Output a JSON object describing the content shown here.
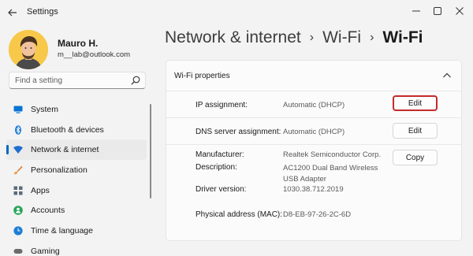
{
  "window": {
    "title": "Settings"
  },
  "user": {
    "name": "Mauro H.",
    "email": "m__lab@outlook.com"
  },
  "search": {
    "placeholder": "Find a setting"
  },
  "sidebar": {
    "items": [
      {
        "label": "System",
        "icon": "system-icon",
        "color": "#0a74d4"
      },
      {
        "label": "Bluetooth & devices",
        "icon": "bluetooth-icon",
        "color": "#1b7ad6"
      },
      {
        "label": "Network & internet",
        "icon": "wifi-icon",
        "color": "#1f6fcf",
        "active": true
      },
      {
        "label": "Personalization",
        "icon": "brush-icon",
        "color": "#d9763a"
      },
      {
        "label": "Apps",
        "icon": "apps-icon",
        "color": "#5b6b7c"
      },
      {
        "label": "Accounts",
        "icon": "accounts-icon",
        "color": "#2aa55b"
      },
      {
        "label": "Time & language",
        "icon": "globe-clock-icon",
        "color": "#1e7ed4"
      },
      {
        "label": "Gaming",
        "icon": "gaming-icon",
        "color": "#6b6b6b"
      }
    ]
  },
  "breadcrumb": {
    "items": [
      "Network & internet",
      "Wi-Fi"
    ],
    "current": "Wi-Fi",
    "separator": "›"
  },
  "panel": {
    "title": "Wi-Fi properties",
    "ip": {
      "label": "IP assignment:",
      "value": "Automatic (DHCP)",
      "button": "Edit"
    },
    "dns": {
      "label": "DNS server assignment:",
      "value": "Automatic (DHCP)",
      "button": "Edit"
    },
    "copy_button": "Copy",
    "details": [
      {
        "label": "Manufacturer:",
        "value": "Realtek Semiconductor Corp."
      },
      {
        "label": "Description:",
        "value": "AC1200  Dual Band Wireless USB Adapter"
      },
      {
        "label": "Driver version:",
        "value": "1030.38.712.2019"
      },
      {
        "label": "Physical address (MAC):",
        "value": "D8-EB-97-26-2C-6D"
      }
    ]
  },
  "colors": {
    "accent": "#0067c0",
    "highlight_border": "#c42a2a",
    "background": "#f3f3f3"
  }
}
